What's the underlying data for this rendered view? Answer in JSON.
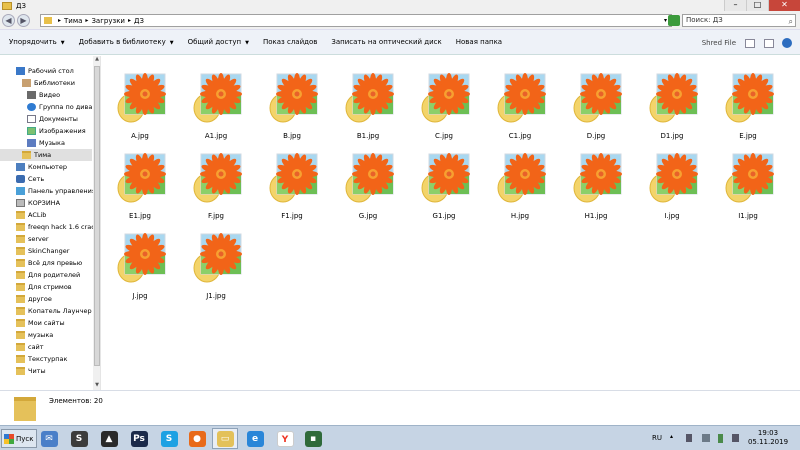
{
  "window": {
    "title": "ДЗ"
  },
  "address": {
    "crumbs": [
      "Тима",
      "Загрузки",
      "ДЗ"
    ],
    "search_placeholder": "Поиск: ДЗ"
  },
  "toolbar": {
    "items": [
      "Упорядочить",
      "Добавить в библиотеку",
      "Общий доступ",
      "Показ слайдов",
      "Записать на оптический диск",
      "Новая папка"
    ],
    "shred": "Shred File"
  },
  "sidebar": {
    "items": [
      {
        "label": "Рабочий стол",
        "icon": "desktop-icon"
      },
      {
        "label": "Библиотеки",
        "icon": "library-icon"
      },
      {
        "label": "Видео",
        "icon": "video-icon"
      },
      {
        "label": "Группа по дива",
        "icon": "group-icon"
      },
      {
        "label": "Документы",
        "icon": "document-icon"
      },
      {
        "label": "Изображения",
        "icon": "image-icon"
      },
      {
        "label": "Музыка",
        "icon": "music-icon"
      },
      {
        "label": "Тима",
        "icon": "user-folder-icon",
        "selected": true
      },
      {
        "label": "Компьютер",
        "icon": "computer-icon"
      },
      {
        "label": "Сеть",
        "icon": "network-icon"
      },
      {
        "label": "Панель управления",
        "icon": "control-panel-icon"
      },
      {
        "label": "КОРЗИНА",
        "icon": "recycle-bin-icon"
      },
      {
        "label": "ACLib",
        "icon": "folder-icon"
      },
      {
        "label": "freeqn hack 1.6 crac",
        "icon": "folder-icon"
      },
      {
        "label": "server",
        "icon": "folder-icon"
      },
      {
        "label": "SkinChanger",
        "icon": "folder-icon"
      },
      {
        "label": "Всё для превью",
        "icon": "folder-icon"
      },
      {
        "label": "Для родителей",
        "icon": "folder-icon"
      },
      {
        "label": "Для стримов",
        "icon": "folder-icon"
      },
      {
        "label": "другое",
        "icon": "folder-icon"
      },
      {
        "label": "Копатель Лаунчер",
        "icon": "folder-icon"
      },
      {
        "label": "Мои сайты",
        "icon": "folder-icon"
      },
      {
        "label": "музыка",
        "icon": "folder-icon"
      },
      {
        "label": "сайт",
        "icon": "folder-icon"
      },
      {
        "label": "Текстурпак",
        "icon": "folder-icon"
      },
      {
        "label": "Читы",
        "icon": "folder-icon"
      }
    ]
  },
  "files": [
    "A.jpg",
    "A1.jpg",
    "B.jpg",
    "B1.jpg",
    "C.jpg",
    "C1.jpg",
    "D.jpg",
    "D1.jpg",
    "E.jpg",
    "E1.jpg",
    "F.jpg",
    "F1.jpg",
    "G.jpg",
    "G1.jpg",
    "H.jpg",
    "H1.jpg",
    "I.jpg",
    "I1.jpg",
    "J.jpg",
    "J1.jpg"
  ],
  "details": {
    "count": "Элементов: 20"
  },
  "taskbar": {
    "start_label": "Пуск",
    "apps": [
      {
        "icon": "mail-icon",
        "color": "#4a7fc8",
        "glyph": "✉"
      },
      {
        "icon": "sublime-text-icon",
        "color": "#3c3c3c",
        "glyph": "S"
      },
      {
        "icon": "game-app-icon",
        "color": "#2a2a2a",
        "glyph": "▲"
      },
      {
        "icon": "photoshop-icon",
        "color": "#1b2a4a",
        "glyph": "Ps"
      },
      {
        "icon": "skype-icon",
        "color": "#1ea1e3",
        "glyph": "S"
      },
      {
        "icon": "firefox-icon",
        "color": "#e86a1a",
        "glyph": "●"
      },
      {
        "icon": "file-explorer-icon",
        "color": "#e3c15a",
        "glyph": "▭"
      },
      {
        "icon": "internet-explorer-icon",
        "color": "#2a86d8",
        "glyph": "e"
      },
      {
        "icon": "yandex-browser-icon",
        "color": "#ffffff",
        "glyph": "Y"
      },
      {
        "icon": "terminal-icon",
        "color": "#2f6a3a",
        "glyph": "▪"
      }
    ],
    "lang": "RU",
    "time": "19:03",
    "date": "05.11.2019"
  }
}
